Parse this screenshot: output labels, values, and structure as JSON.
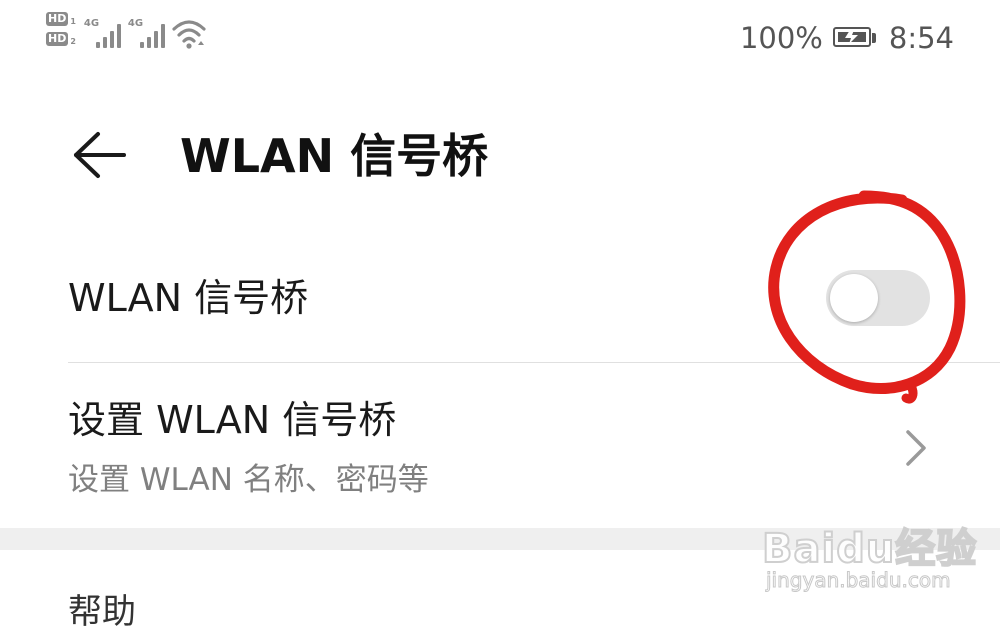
{
  "status_bar": {
    "sim1_badge": "HD",
    "sim1_index": "1",
    "sim2_badge": "HD",
    "sim2_index": "2",
    "signal1_type": "4G",
    "signal2_type": "4G",
    "wifi_icon": "wifi-icon",
    "battery_percent": "100%",
    "battery_icon": "battery-charging-icon",
    "time": "8:54"
  },
  "header": {
    "back_icon": "arrow-left-icon",
    "title": "WLAN 信号桥"
  },
  "settings": {
    "toggle_row": {
      "label": "WLAN 信号桥",
      "toggle_state": "off"
    },
    "setup_row": {
      "title": "设置 WLAN 信号桥",
      "subtitle": "设置 WLAN 名称、密码等",
      "chevron_icon": "chevron-right-icon"
    }
  },
  "help_section": {
    "header": "帮助"
  },
  "annotation": {
    "color": "#e0201b",
    "shape": "hand-drawn circle around toggle"
  },
  "watermark": {
    "brand": "Baidu经验",
    "url": "jingyan.baidu.com"
  },
  "colors": {
    "background": "#ffffff",
    "text_primary": "#1a1a1a",
    "text_secondary": "#808080",
    "toggle_off_track": "#e2e2e2",
    "section_gap": "#efefef"
  }
}
